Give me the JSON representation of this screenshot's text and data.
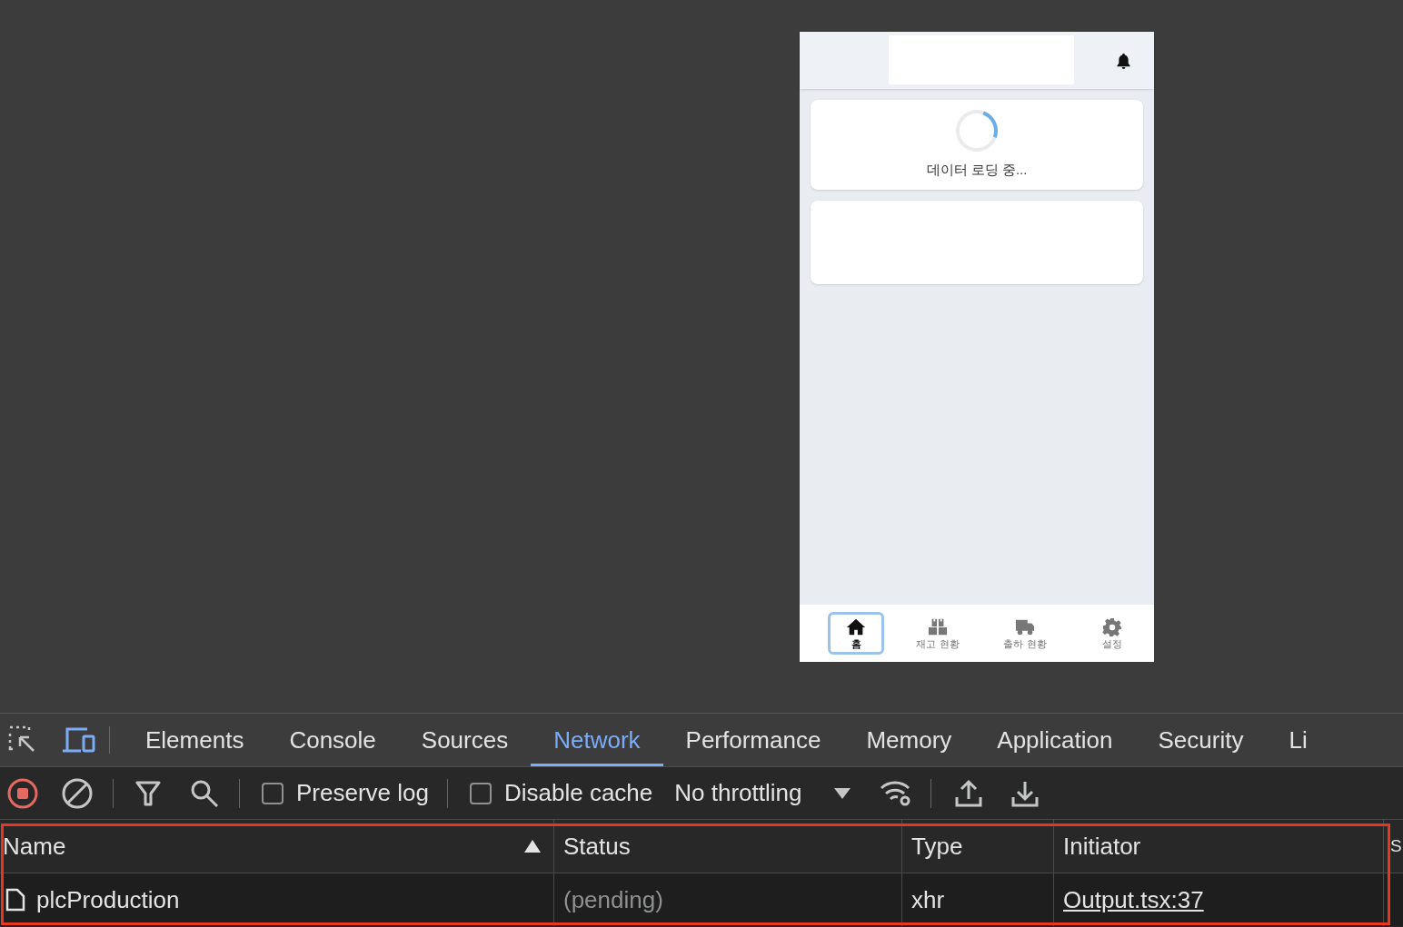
{
  "phone": {
    "loading_card": {
      "message": "데이터 로딩 중..."
    },
    "nav_items": [
      {
        "label": "홈",
        "selected": true
      },
      {
        "label": "재고 현황",
        "selected": false
      },
      {
        "label": "출하 현황",
        "selected": false
      },
      {
        "label": "설정",
        "selected": false
      }
    ]
  },
  "devtools": {
    "tabs": [
      {
        "label": "Elements",
        "selected": false
      },
      {
        "label": "Console",
        "selected": false
      },
      {
        "label": "Sources",
        "selected": false
      },
      {
        "label": "Network",
        "selected": true
      },
      {
        "label": "Performance",
        "selected": false
      },
      {
        "label": "Memory",
        "selected": false
      },
      {
        "label": "Application",
        "selected": false
      },
      {
        "label": "Security",
        "selected": false
      },
      {
        "label": "Li",
        "selected": false
      }
    ],
    "toolbar": {
      "checkboxes": [
        {
          "label": "Preserve log",
          "checked": false
        },
        {
          "label": "Disable cache",
          "checked": false
        }
      ],
      "throttling": "No throttling"
    },
    "table": {
      "columns": [
        {
          "label": "Name",
          "sorted": true
        },
        {
          "label": "Status",
          "sorted": false
        },
        {
          "label": "Type",
          "sorted": false
        },
        {
          "label": "Initiator",
          "sorted": false
        },
        {
          "label": "S"
        }
      ],
      "rows": [
        {
          "name": "plcProduction",
          "status": "(pending)",
          "type": "xhr",
          "initiator": "Output.tsx:37"
        }
      ]
    }
  }
}
